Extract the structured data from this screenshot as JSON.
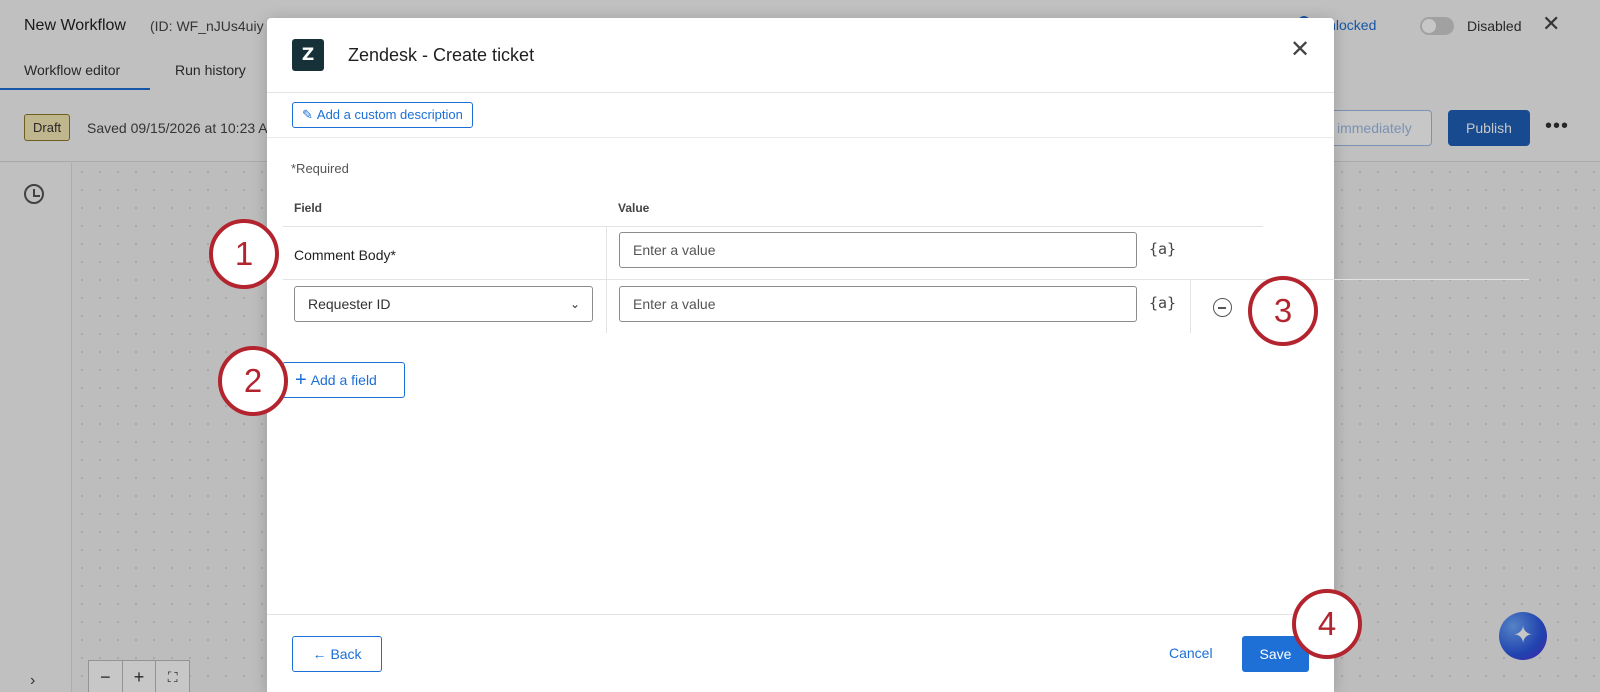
{
  "app": {
    "title": "New Workflow",
    "id_label": "(ID: WF_nJUs4uiy",
    "lock_status": "Unlocked",
    "status_label": "Disabled",
    "tabs": [
      {
        "label": "Workflow editor"
      },
      {
        "label": "Run history"
      }
    ],
    "draft_badge": "Draft",
    "saved_text": "Saved 09/15/2026 at 10:23 A",
    "immediately_label": "immediately",
    "publish_label": "Publish"
  },
  "modal": {
    "title": "Zendesk - Create ticket",
    "logo_letter": "Z",
    "custom_description_label": "Add a custom description",
    "required_note": "*Required",
    "columns": {
      "field": "Field",
      "value": "Value"
    },
    "rows": [
      {
        "field": "Comment Body*",
        "value_placeholder": "Enter a value"
      },
      {
        "field": "Requester ID",
        "value_placeholder": "Enter a value"
      }
    ],
    "piped_text_icon": "{a}",
    "add_field_label": "Add a field",
    "back_label": "Back",
    "cancel_label": "Cancel",
    "save_label": "Save"
  },
  "callouts": [
    "1",
    "2",
    "3",
    "4"
  ],
  "colors": {
    "accent": "#1b6fd6",
    "callout": "#b3242e",
    "logo_bg": "#163238"
  }
}
